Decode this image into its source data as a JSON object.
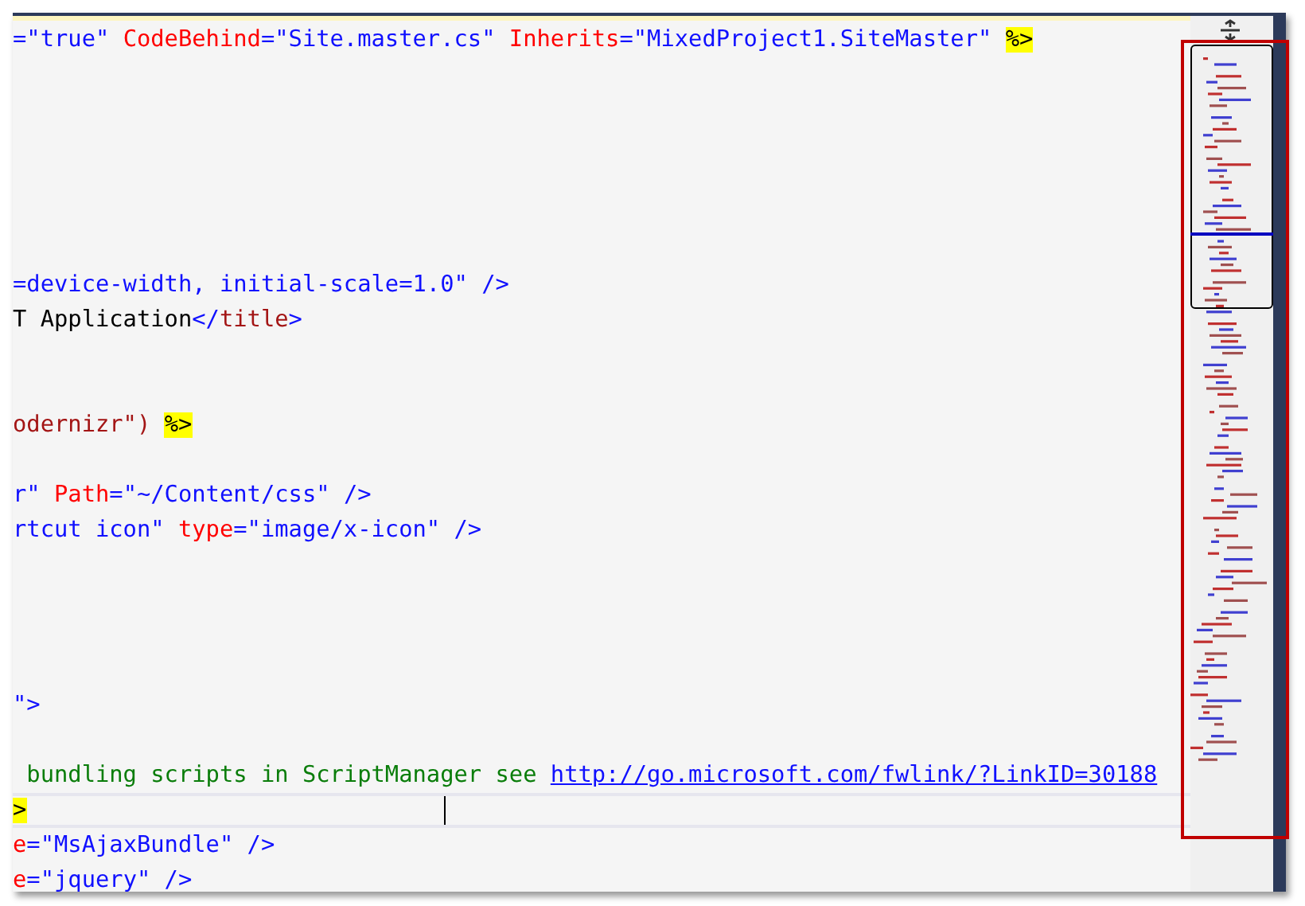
{
  "editor": {
    "lines": [
      {
        "current": false,
        "tokens": [
          {
            "kind": "value",
            "text": "=\"true\" "
          },
          {
            "kind": "attr",
            "text": "CodeBehind"
          },
          {
            "kind": "value",
            "text": "=\"Site.master.cs\" "
          },
          {
            "kind": "attr",
            "text": "Inherits"
          },
          {
            "kind": "value",
            "text": "=\"MixedProject1.SiteMaster\" "
          },
          {
            "kind": "server",
            "text": "%>"
          }
        ]
      },
      {
        "current": false
      },
      {
        "current": false
      },
      {
        "current": false
      },
      {
        "current": false
      },
      {
        "current": false
      },
      {
        "current": false
      },
      {
        "current": false,
        "tokens": [
          {
            "kind": "value",
            "text": "=device-width, initial-scale=1.0\" />"
          }
        ]
      },
      {
        "current": false,
        "tokens": [
          {
            "kind": "text",
            "text": "T Application"
          },
          {
            "kind": "value",
            "text": "</"
          },
          {
            "kind": "tag",
            "text": "title"
          },
          {
            "kind": "value",
            "text": ">"
          }
        ]
      },
      {
        "current": false
      },
      {
        "current": false
      },
      {
        "current": false,
        "tokens": [
          {
            "kind": "tag",
            "text": "odernizr\") "
          },
          {
            "kind": "server",
            "text": "%>"
          }
        ]
      },
      {
        "current": false
      },
      {
        "current": false,
        "tokens": [
          {
            "kind": "value",
            "text": "r\" "
          },
          {
            "kind": "attr",
            "text": "Path"
          },
          {
            "kind": "value",
            "text": "=\"~/Content/css\" />"
          }
        ]
      },
      {
        "current": false,
        "tokens": [
          {
            "kind": "value",
            "text": "rtcut icon\" "
          },
          {
            "kind": "attr",
            "text": "type"
          },
          {
            "kind": "value",
            "text": "=\"image/x-icon\" />"
          }
        ]
      },
      {
        "current": false
      },
      {
        "current": false
      },
      {
        "current": false
      },
      {
        "current": false
      },
      {
        "current": false,
        "tokens": [
          {
            "kind": "value",
            "text": "\">"
          }
        ]
      },
      {
        "current": false
      },
      {
        "current": false,
        "tokens": [
          {
            "kind": "comment",
            "text": " bundling scripts in ScriptManager see "
          },
          {
            "kind": "link",
            "text": "http://go.microsoft.com/fwlink/?LinkID=30188"
          }
        ]
      },
      {
        "current": true,
        "tokens": [
          {
            "kind": "server",
            "text": ">"
          }
        ]
      },
      {
        "current": false,
        "tokens": [
          {
            "kind": "attr",
            "text": "e"
          },
          {
            "kind": "value",
            "text": "=\"MsAjaxBundle\" />"
          }
        ]
      },
      {
        "current": false,
        "tokens": [
          {
            "kind": "attr",
            "text": "e"
          },
          {
            "kind": "value",
            "text": "=\"jquery\" />"
          }
        ]
      }
    ]
  }
}
